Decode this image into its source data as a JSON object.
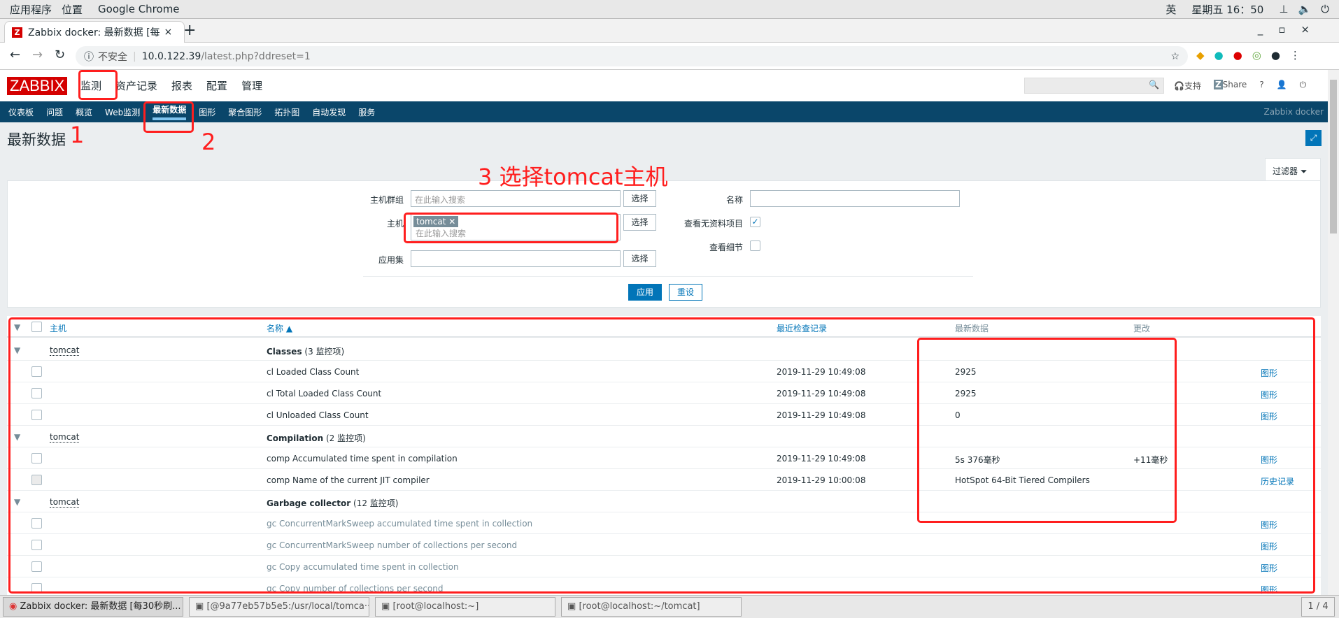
{
  "os": {
    "apps": "应用程序",
    "places": "位置",
    "app_name": "Google Chrome",
    "ime": "英",
    "clock": "星期五 16：50"
  },
  "browser": {
    "tab_title": "Zabbix docker: 最新数据 [每",
    "url_warning": "不安全",
    "url_host": "10.0.122.39",
    "url_path": "/latest.php?ddreset=1"
  },
  "zabbix": {
    "logo": "ZABBIX",
    "menu": [
      "监测",
      "资产记录",
      "报表",
      "配置",
      "管理"
    ],
    "support": "支持",
    "share": "Share",
    "help": "?",
    "subnav": [
      "仪表板",
      "问题",
      "概览",
      "Web监测",
      "最新数据",
      "图形",
      "聚合图形",
      "拓扑图",
      "自动发现",
      "服务"
    ],
    "server_name": "Zabbix docker",
    "page_title": "最新数据"
  },
  "filter": {
    "tab": "过滤器",
    "host_groups_label": "主机群组",
    "host_groups_placeholder": "在此输入搜索",
    "select": "选择",
    "host_label": "主机",
    "host_chip": "tomcat",
    "host_placeholder": "在此输入搜索",
    "app_label": "应用集",
    "name_label": "名称",
    "show_no_data_label": "查看无资料项目",
    "show_details_label": "查看细节",
    "apply": "应用",
    "reset": "重设"
  },
  "annotations": {
    "a1": "1",
    "a2": "2",
    "a3": "3 选择tomcat主机"
  },
  "table": {
    "headers": {
      "host": "主机",
      "name": "名称 ▲",
      "last_check": "最近检查记录",
      "last_value": "最新数据",
      "change": "更改"
    },
    "rows": [
      {
        "group": true,
        "host": "tomcat",
        "name": "Classes",
        "count": "(3 监控项)"
      },
      {
        "name": "cl Loaded Class Count",
        "last_check": "2019-11-29 10:49:08",
        "value": "2925",
        "change": "",
        "link": "图形"
      },
      {
        "name": "cl Total Loaded Class Count",
        "last_check": "2019-11-29 10:49:08",
        "value": "2925",
        "change": "",
        "link": "图形"
      },
      {
        "name": "cl Unloaded Class Count",
        "last_check": "2019-11-29 10:49:08",
        "value": "0",
        "change": "",
        "link": "图形"
      },
      {
        "group": true,
        "host": "tomcat",
        "name": "Compilation",
        "count": "(2 监控项)"
      },
      {
        "name": "comp Accumulated time spent in compilation",
        "last_check": "2019-11-29 10:49:08",
        "value": "5s 376毫秒",
        "change": "+11毫秒",
        "link": "图形"
      },
      {
        "name": "comp Name of the current JIT compiler",
        "last_check": "2019-11-29 10:00:08",
        "value": "HotSpot 64-Bit Tiered Compilers",
        "change": "",
        "link": "历史记录",
        "disabled": true
      },
      {
        "group": true,
        "host": "tomcat",
        "name": "Garbage collector",
        "count": "(12 监控项)"
      },
      {
        "name": "gc ConcurrentMarkSweep accumulated time spent in collection",
        "last_check": "",
        "value": "",
        "change": "",
        "link": "图形",
        "nodata": true
      },
      {
        "name": "gc ConcurrentMarkSweep number of collections per second",
        "last_check": "",
        "value": "",
        "change": "",
        "link": "图形",
        "nodata": true
      },
      {
        "name": "gc Copy accumulated time spent in collection",
        "last_check": "",
        "value": "",
        "change": "",
        "link": "图形",
        "nodata": true
      },
      {
        "name": "gc Copy number of collections per second",
        "last_check": "",
        "value": "",
        "change": "",
        "link": "图形",
        "nodata": true
      }
    ]
  },
  "taskbar": {
    "items": [
      "Zabbix docker: 最新数据 [每30秒刷...",
      "[@9a77eb57b5e5:/usr/local/tomca···",
      "[root@localhost:~]",
      "[root@localhost:~/tomcat]"
    ],
    "workspace": "1 / 4"
  }
}
